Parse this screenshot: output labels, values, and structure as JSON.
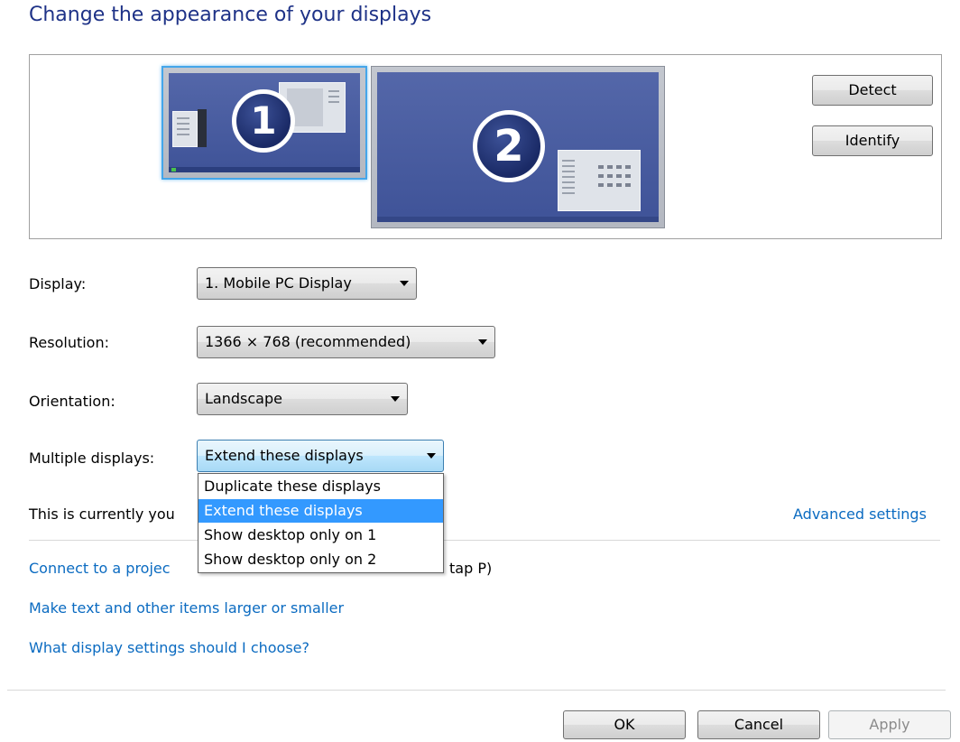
{
  "page": {
    "title": "Change the appearance of your displays"
  },
  "preview": {
    "monitor1_number": "1",
    "monitor2_number": "2",
    "detect_label": "Detect",
    "identify_label": "Identify"
  },
  "form": {
    "display_label": "Display:",
    "display_value": "1. Mobile PC Display",
    "resolution_label": "Resolution:",
    "resolution_value": "1366 × 768 (recommended)",
    "orientation_label": "Orientation:",
    "orientation_value": "Landscape",
    "multiple_label": "Multiple displays:",
    "multiple_value": "Extend these displays",
    "multiple_options": [
      "Duplicate these displays",
      "Extend these displays",
      "Show desktop only on 1",
      "Show desktop only on 2"
    ],
    "multiple_selected_index": 1
  },
  "info": {
    "current_display_text_visible": "This is currently you",
    "advanced_settings": "Advanced settings",
    "connect_projector_visible_left": "Connect to a projec",
    "connect_projector_visible_right": "tap P)"
  },
  "links": {
    "text_size": "Make text and other items larger or smaller",
    "which_settings": "What display settings should I choose?"
  },
  "footer": {
    "ok": "OK",
    "cancel": "Cancel",
    "apply": "Apply"
  },
  "colors": {
    "title": "#1e3287",
    "link": "#0b6bc1",
    "selection": "#3399ff",
    "monitor_screen": "#4a5ea3",
    "monitor_selected_border": "#44a6ea"
  }
}
